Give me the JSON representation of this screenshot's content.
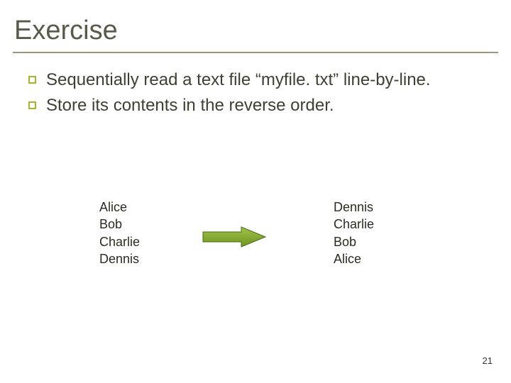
{
  "title": "Exercise",
  "bullets": [
    "Sequentially read a text file “myfile. txt” line-by-line.",
    "Store its contents in the reverse order."
  ],
  "example": {
    "input": [
      "Alice",
      "Bob",
      "Charlie",
      "Dennis"
    ],
    "output": [
      "Dennis",
      "Charlie",
      "Bob",
      "Alice"
    ]
  },
  "colors": {
    "accent": "#a7b32b",
    "arrow_fill": "#7ea528",
    "arrow_stroke": "#4a6a18"
  },
  "page_number": "21"
}
